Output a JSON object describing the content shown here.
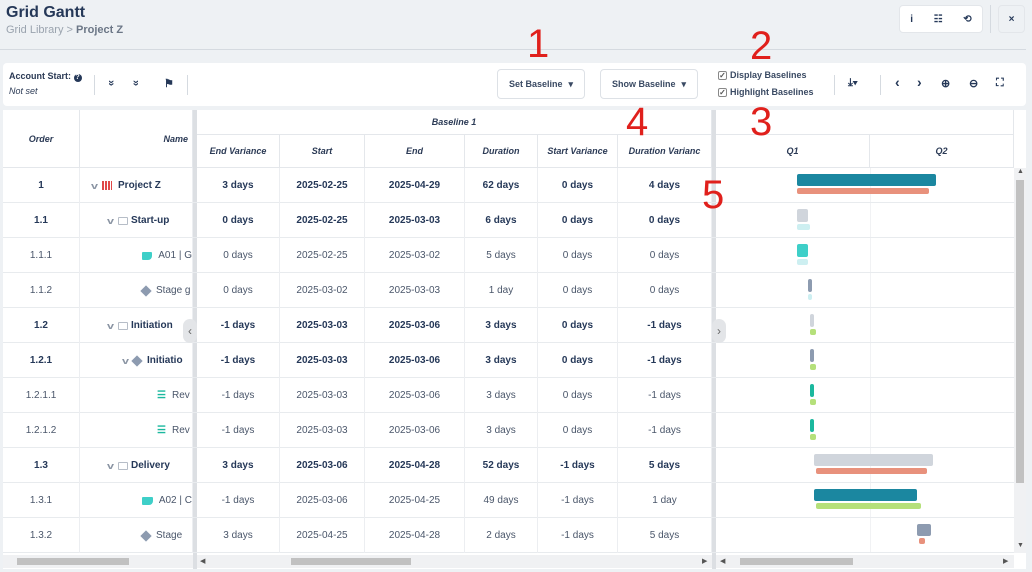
{
  "header": {
    "title": "Grid Gantt",
    "breadcrumb_parent": "Grid Library",
    "breadcrumb_sep": ">",
    "breadcrumb_current": "Project Z",
    "info_icon": "i",
    "list_icon": "☷",
    "history_icon": "⟲",
    "close_icon": "×"
  },
  "toolbar": {
    "account_start_label": "Account Start:",
    "help_icon": "?",
    "account_start_value": "Not set",
    "expand_icon": "»",
    "collapse_icon": "«",
    "filter_clear_icon": "⚑",
    "set_baseline": "Set Baseline",
    "show_baseline": "Show Baseline",
    "dropdown_icon": "▾",
    "display_baselines": "Display Baselines",
    "highlight_baselines": "Highlight Baselines",
    "display_baselines_checked": true,
    "highlight_baselines_checked": true,
    "export_icon": "⤓",
    "prev_icon": "‹",
    "next_icon": "›",
    "zoom_in_icon": "⊕",
    "zoom_out_icon": "⊖",
    "fit_icon": "⛶"
  },
  "annotations": [
    "1",
    "2",
    "3",
    "4",
    "5"
  ],
  "columns": {
    "order": "Order",
    "name": "Name",
    "group": "Baseline 1",
    "end_variance": "End Variance",
    "start": "Start",
    "end": "End",
    "duration": "Duration",
    "start_variance": "Start Variance",
    "duration_variance": "Duration Varianc"
  },
  "timeline": {
    "q1": "Q1",
    "q2": "Q2"
  },
  "rows": [
    {
      "order": "1",
      "name": "Project Z",
      "level": 0,
      "type": "project",
      "bold": true,
      "chevron": true,
      "end_variance": "3 days",
      "start": "2025-02-25",
      "end": "2025-04-29",
      "duration": "62 days",
      "start_variance": "0 days",
      "duration_variance": "4 days"
    },
    {
      "order": "1.1",
      "name": "Start-up",
      "level": 1,
      "type": "phase",
      "bold": true,
      "chevron": true,
      "end_variance": "0 days",
      "start": "2025-02-25",
      "end": "2025-03-03",
      "duration": "6 days",
      "start_variance": "0 days",
      "duration_variance": "0 days"
    },
    {
      "order": "1.1.1",
      "name": "A01 | G",
      "level": 3,
      "type": "task",
      "bold": false,
      "chevron": false,
      "end_variance": "0 days",
      "start": "2025-02-25",
      "end": "2025-03-02",
      "duration": "5 days",
      "start_variance": "0 days",
      "duration_variance": "0 days"
    },
    {
      "order": "1.1.2",
      "name": "Stage g",
      "level": 3,
      "type": "milestone",
      "bold": false,
      "chevron": false,
      "end_variance": "0 days",
      "start": "2025-03-02",
      "end": "2025-03-03",
      "duration": "1 day",
      "start_variance": "0 days",
      "duration_variance": "0 days"
    },
    {
      "order": "1.2",
      "name": "Initiation",
      "level": 1,
      "type": "phase",
      "bold": true,
      "chevron": true,
      "end_variance": "-1 days",
      "start": "2025-03-03",
      "end": "2025-03-06",
      "duration": "3 days",
      "start_variance": "0 days",
      "duration_variance": "-1 days"
    },
    {
      "order": "1.2.1",
      "name": "Initiatio",
      "level": 2,
      "type": "milestone",
      "bold": true,
      "chevron": true,
      "end_variance": "-1 days",
      "start": "2025-03-03",
      "end": "2025-03-06",
      "duration": "3 days",
      "start_variance": "0 days",
      "duration_variance": "-1 days"
    },
    {
      "order": "1.2.1.1",
      "name": "Rev",
      "level": 4,
      "type": "list",
      "bold": false,
      "chevron": false,
      "end_variance": "-1 days",
      "start": "2025-03-03",
      "end": "2025-03-06",
      "duration": "3 days",
      "start_variance": "0 days",
      "duration_variance": "-1 days"
    },
    {
      "order": "1.2.1.2",
      "name": "Rev",
      "level": 4,
      "type": "list",
      "bold": false,
      "chevron": false,
      "end_variance": "-1 days",
      "start": "2025-03-03",
      "end": "2025-03-06",
      "duration": "3 days",
      "start_variance": "0 days",
      "duration_variance": "-1 days"
    },
    {
      "order": "1.3",
      "name": "Delivery",
      "level": 1,
      "type": "phase",
      "bold": true,
      "chevron": true,
      "end_variance": "3 days",
      "start": "2025-03-06",
      "end": "2025-04-28",
      "duration": "52 days",
      "start_variance": "-1 days",
      "duration_variance": "5 days"
    },
    {
      "order": "1.3.1",
      "name": "A02 | C",
      "level": 3,
      "type": "task",
      "bold": false,
      "chevron": false,
      "end_variance": "-1 days",
      "start": "2025-03-06",
      "end": "2025-04-25",
      "duration": "49 days",
      "start_variance": "-1 days",
      "duration_variance": "1 day"
    },
    {
      "order": "1.3.2",
      "name": "Stage",
      "level": 3,
      "type": "milestone",
      "bold": false,
      "chevron": false,
      "end_variance": "3 days",
      "start": "2025-04-25",
      "end": "2025-04-28",
      "duration": "2 days",
      "start_variance": "-1 days",
      "duration_variance": "5 days"
    }
  ],
  "gantt_bars": [
    {
      "current": [
        "2025-02-25",
        "2025-05-02"
      ],
      "current_color": "#1b87a0",
      "baseline": [
        "2025-02-25",
        "2025-04-29"
      ],
      "baseline_color": "#e8917c"
    },
    {
      "current": [
        "2025-02-25",
        "2025-03-02"
      ],
      "current_color": "#d0d5dc",
      "baseline": [
        "2025-02-25",
        "2025-03-03"
      ],
      "baseline_color": "#cdeff1"
    },
    {
      "current": [
        "2025-02-25",
        "2025-03-02"
      ],
      "current_color": "#3ecfc8",
      "baseline": [
        "2025-02-25",
        "2025-03-02"
      ],
      "baseline_color": "#cdeff1"
    },
    {
      "current": [
        "2025-03-02",
        "2025-03-04"
      ],
      "current_color": "#8d9bb0",
      "baseline": [
        "2025-03-02",
        "2025-03-04"
      ],
      "baseline_color": "#cdeff1"
    },
    {
      "current": [
        "2025-03-03",
        "2025-03-05"
      ],
      "current_color": "#d0d5dc",
      "baseline": [
        "2025-03-03",
        "2025-03-06"
      ],
      "baseline_color": "#b5e07a"
    },
    {
      "current": [
        "2025-03-03",
        "2025-03-05"
      ],
      "current_color": "#8d9bb0",
      "baseline": [
        "2025-03-03",
        "2025-03-06"
      ],
      "baseline_color": "#b5e07a"
    },
    {
      "current": [
        "2025-03-03",
        "2025-03-05"
      ],
      "current_color": "#1bb89e",
      "baseline": [
        "2025-03-03",
        "2025-03-06"
      ],
      "baseline_color": "#b5e07a"
    },
    {
      "current": [
        "2025-03-03",
        "2025-03-05"
      ],
      "current_color": "#1bb89e",
      "baseline": [
        "2025-03-03",
        "2025-03-06"
      ],
      "baseline_color": "#b5e07a"
    },
    {
      "current": [
        "2025-03-05",
        "2025-05-01"
      ],
      "current_color": "#d0d5dc",
      "baseline": [
        "2025-03-06",
        "2025-04-28"
      ],
      "baseline_color": "#e8917c"
    },
    {
      "current": [
        "2025-03-05",
        "2025-04-23"
      ],
      "current_color": "#1b87a0",
      "baseline": [
        "2025-03-06",
        "2025-04-25"
      ],
      "baseline_color": "#b5e07a"
    },
    {
      "current": [
        "2025-04-23",
        "2025-04-30"
      ],
      "current_color": "#8d9bb0",
      "baseline": [
        "2025-04-24",
        "2025-04-27"
      ],
      "baseline_color": "#e8917c"
    }
  ]
}
